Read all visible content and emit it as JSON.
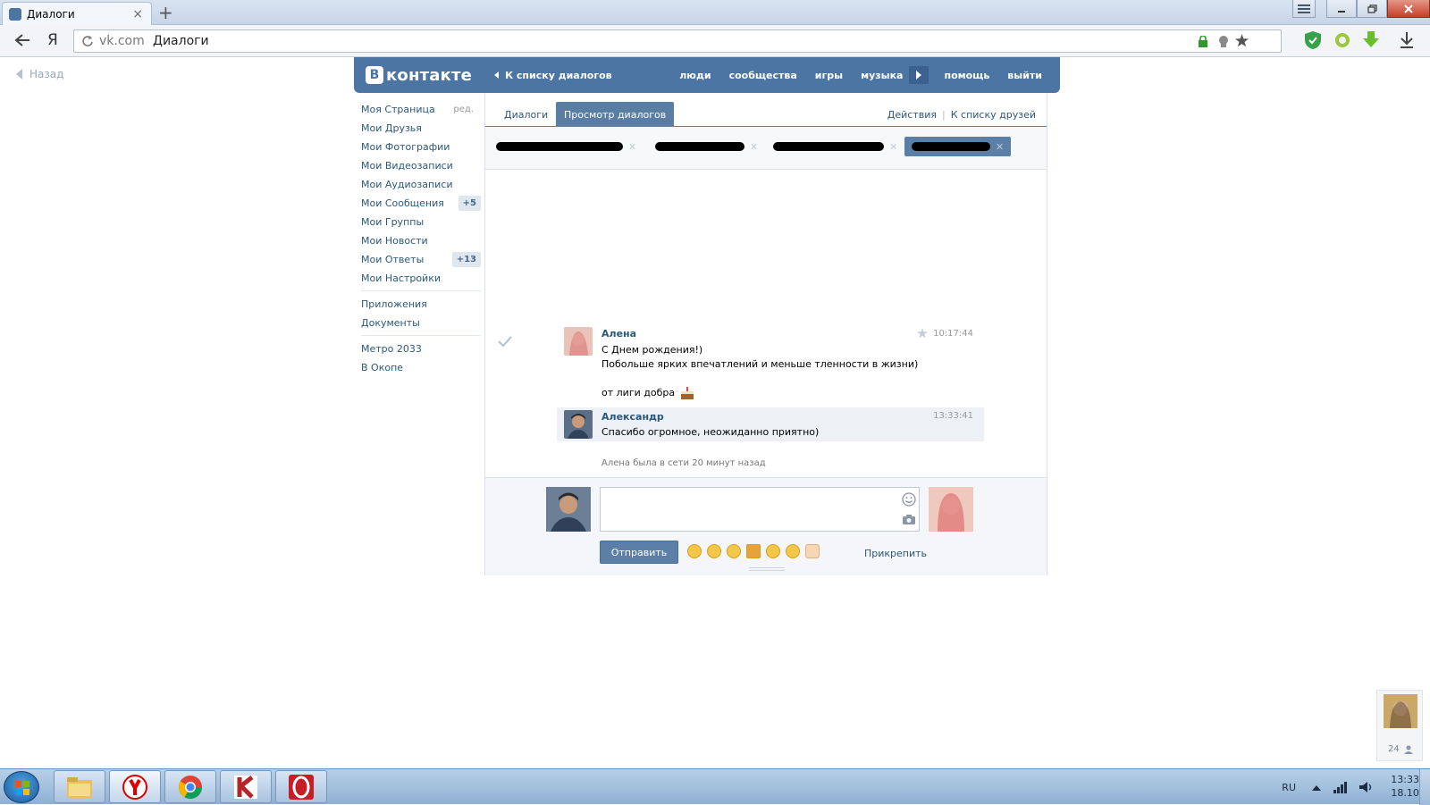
{
  "browser": {
    "tab_title": "Диалоги",
    "tab_close": "×",
    "new_tab": "+",
    "yandex_button": "Я",
    "address_host": "vk.com",
    "address_title": "Диалоги"
  },
  "page_back": "Назад",
  "vk": {
    "logo_letter": "В",
    "logo_text": "контакте",
    "back_to_list": "К списку диалогов",
    "nav": [
      "люди",
      "сообщества",
      "игры",
      "музыка",
      "помощь",
      "выйти"
    ]
  },
  "left_menu": {
    "edit_label": "ред.",
    "items": [
      {
        "label": "Моя Страница"
      },
      {
        "label": "Мои Друзья"
      },
      {
        "label": "Мои Фотографии"
      },
      {
        "label": "Мои Видеозаписи"
      },
      {
        "label": "Мои Аудиозаписи"
      },
      {
        "label": "Мои Сообщения",
        "badge": "+5"
      },
      {
        "label": "Мои Группы"
      },
      {
        "label": "Мои Новости"
      },
      {
        "label": "Мои Ответы",
        "badge": "+13"
      },
      {
        "label": "Мои Настройки"
      }
    ],
    "extra": [
      "Приложения",
      "Документы"
    ],
    "apps": [
      "Метро 2033",
      "В Окопе"
    ]
  },
  "tabs": {
    "dialogs": "Диалоги",
    "view_dialogs": "Просмотр диалогов",
    "actions": "Действия",
    "separator": "|",
    "to_friends": "К списку друзей"
  },
  "messages": [
    {
      "author": "Алена",
      "time": "10:17:44",
      "lines": [
        "С Днем рождения!)",
        "Побольше ярких впечатлений и меньше тленности в жизни)",
        "",
        "от лиги добра"
      ]
    },
    {
      "author": "Александр",
      "time": "13:33:41",
      "lines": [
        "Спасибо огромное, неожиданно приятно)"
      ]
    }
  ],
  "last_seen": "Алена была в сети 20 минут назад",
  "compose": {
    "message_value": "",
    "send_label": "Отправить",
    "attach_label": "Прикрепить"
  },
  "friend_widget": {
    "count": "24"
  },
  "taskbar": {
    "lang": "RU",
    "time": "13:33",
    "date": "18.10"
  },
  "colors": {
    "vk_blue": "#4c75a3",
    "vk_link": "#2b587a",
    "active_tab": "#597da3"
  }
}
